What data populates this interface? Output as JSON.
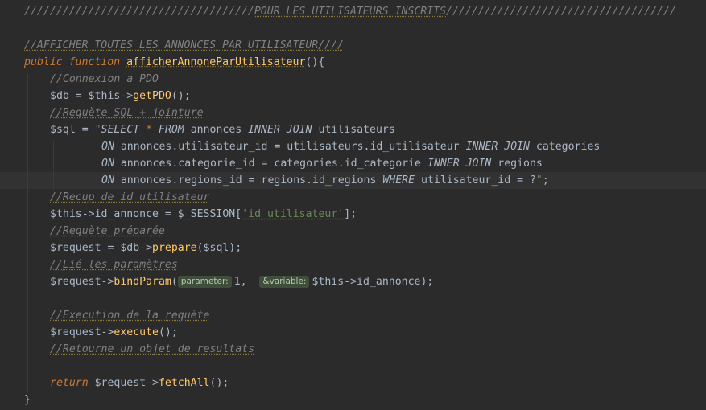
{
  "code": {
    "l1": {
      "slashes_a": "////////////////////////////////////",
      "section": "POUR LES UTILISATEURS INSCRITS",
      "slashes_b": "////////////////////////////////////"
    },
    "l2": {
      "comment": "//AFFICHER TOUTES LES ANNONCES PAR UTILISATEUR////"
    },
    "l3": {
      "kw_public": "public",
      "kw_function": "function",
      "name": "afficherAnnoneParUtilisateur",
      "rest": "(){"
    },
    "l4": {
      "comment": "//Connexion a PDO"
    },
    "l5": {
      "a": "$db = $this->",
      "fn": "getPDO",
      "b": "();"
    },
    "l6": {
      "comment": "//Requète SQL + jointure"
    },
    "l7": {
      "a": "$sql = ",
      "q": "\"",
      "kw1": "SELECT",
      "star": " * ",
      "kw2": "FROM",
      "t1": " annonces ",
      "kw3": "INNER JOIN",
      "t2": " utilisateurs"
    },
    "l8": {
      "kw1": "ON",
      "t1": " annonces.utilisateur_id = utilisateurs.id_utilisateur ",
      "kw2": "INNER JOIN",
      "t2": " categories"
    },
    "l9": {
      "kw1": "ON",
      "t1": " annonces.categorie_id = categories.id_categorie ",
      "kw2": "INNER JOIN",
      "t2": " regions"
    },
    "l10": {
      "kw1": "ON",
      "t1": " annonces.regions_id = regions.id_regions ",
      "kw2": "WHERE",
      "t2": " utilisateur_id = ?",
      "q": "\"",
      "end": ";"
    },
    "l11": {
      "comment": "//Recup de id utilisateur"
    },
    "l12": {
      "a": "$this->id_annonce = $_SESSION[",
      "str": "'id_utilisateur'",
      "b": "];"
    },
    "l13": {
      "comment": "//Requète préparée"
    },
    "l14": {
      "a": "$request = $db->",
      "fn": "prepare",
      "b": "($sql);"
    },
    "l15": {
      "comment": "//Lié les paramètres"
    },
    "l16": {
      "a": "$request->",
      "fn": "bindParam",
      "b": "(",
      "hint1": "parameter:",
      "c": "1,  ",
      "hint2": "&variable:",
      "d": "$this->id_annonce);"
    },
    "l18": {
      "comment": "//Execution de la requète"
    },
    "l19": {
      "a": "$request->",
      "fn": "execute",
      "b": "();"
    },
    "l20": {
      "comment": "//Retourne un objet de resultats"
    },
    "l22": {
      "kw": "return",
      "a": " $request->",
      "fn": "fetchAll",
      "b": "();"
    },
    "l23": {
      "brace": "}"
    }
  },
  "colors": {
    "background": "#2b2b2b",
    "text": "#a9b7c6",
    "keyword": "#cc7832",
    "function": "#ffc66d",
    "string": "#6a8759",
    "comment": "#808080"
  }
}
